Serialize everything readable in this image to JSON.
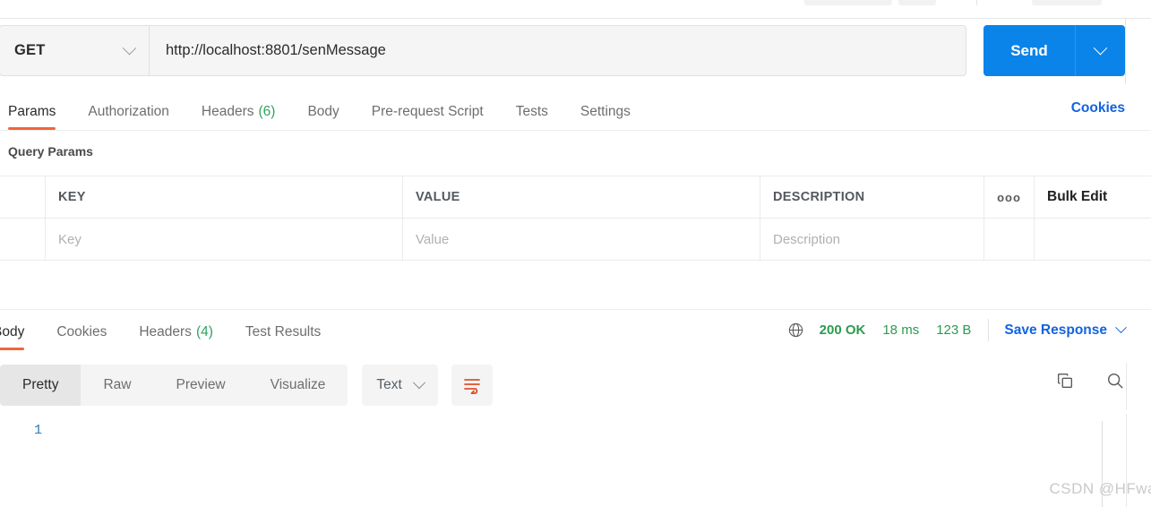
{
  "request": {
    "method": "GET",
    "url": "http://localhost:8801/senMessage",
    "send_label": "Send",
    "tabs": [
      {
        "label": "Params",
        "count": ""
      },
      {
        "label": "Authorization",
        "count": ""
      },
      {
        "label": "Headers",
        "count": "(6)"
      },
      {
        "label": "Body",
        "count": ""
      },
      {
        "label": "Pre-request Script",
        "count": ""
      },
      {
        "label": "Tests",
        "count": ""
      },
      {
        "label": "Settings",
        "count": ""
      }
    ],
    "cookies_link": "Cookies"
  },
  "query_params": {
    "section_title": "Query Params",
    "headers": {
      "key": "KEY",
      "value": "VALUE",
      "description": "DESCRIPTION"
    },
    "options_icon": "ooo",
    "bulk_edit_label": "Bulk Edit",
    "row_placeholders": {
      "key": "Key",
      "value": "Value",
      "description": "Description"
    }
  },
  "response": {
    "tabs": [
      {
        "label": "Body",
        "count": ""
      },
      {
        "label": "Cookies",
        "count": ""
      },
      {
        "label": "Headers",
        "count": "(4)"
      },
      {
        "label": "Test Results",
        "count": ""
      }
    ],
    "status": "200 OK",
    "time": "18 ms",
    "size": "123 B",
    "save_response_label": "Save Response",
    "format_tabs": [
      "Pretty",
      "Raw",
      "Preview",
      "Visualize"
    ],
    "active_format": "Pretty",
    "language": "Text",
    "line_numbers": [
      "1"
    ],
    "body_text": ""
  },
  "colors": {
    "accent_orange": "#f0663c",
    "link_blue": "#1263e0",
    "send_blue": "#0a84e8",
    "status_green": "#2c9b4f"
  },
  "watermark": "CSDN @HFwa"
}
